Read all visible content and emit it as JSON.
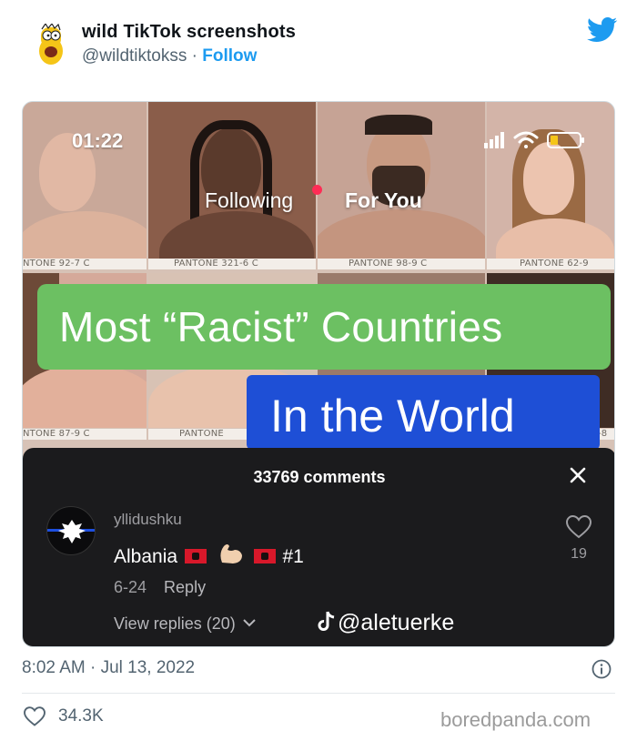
{
  "tweet": {
    "account_name": "wild TikTok screenshots",
    "handle": "@wildtiktokss",
    "separator": "·",
    "follow_label": "Follow",
    "timestamp": "8:02 AM · Jul 13, 2022",
    "likes": "34.3K",
    "source_watermark": "boredpanda.com"
  },
  "tiktok": {
    "status_time": "01:22",
    "tab_following": "Following",
    "tab_for_you": "For You",
    "pantone_labels": [
      "NTONE 92-7 C",
      "PANTONE 321-6 C",
      "PANTONE 98-9 C",
      "PANTONE 62-9",
      "NTONE 87-9 C",
      "PANTONE",
      "-8"
    ],
    "banner_line_1": "Most “Racist” Countries",
    "banner_line_2": "In the World",
    "comments_count": "33769 comments",
    "comment": {
      "username": "yllidushku",
      "text_start": "Albania",
      "text_end": "#1",
      "date": "6-24",
      "reply_label": "Reply",
      "view_replies": "View replies (20)",
      "likes": "19"
    },
    "watermark": "@aletuerke"
  },
  "colors": {
    "twitter_blue": "#1d9bf0",
    "banner_green": "#6cc062",
    "banner_blue": "#1e4fd6",
    "comments_bg": "#1b1b1d",
    "live_dot": "#fe2c55"
  }
}
